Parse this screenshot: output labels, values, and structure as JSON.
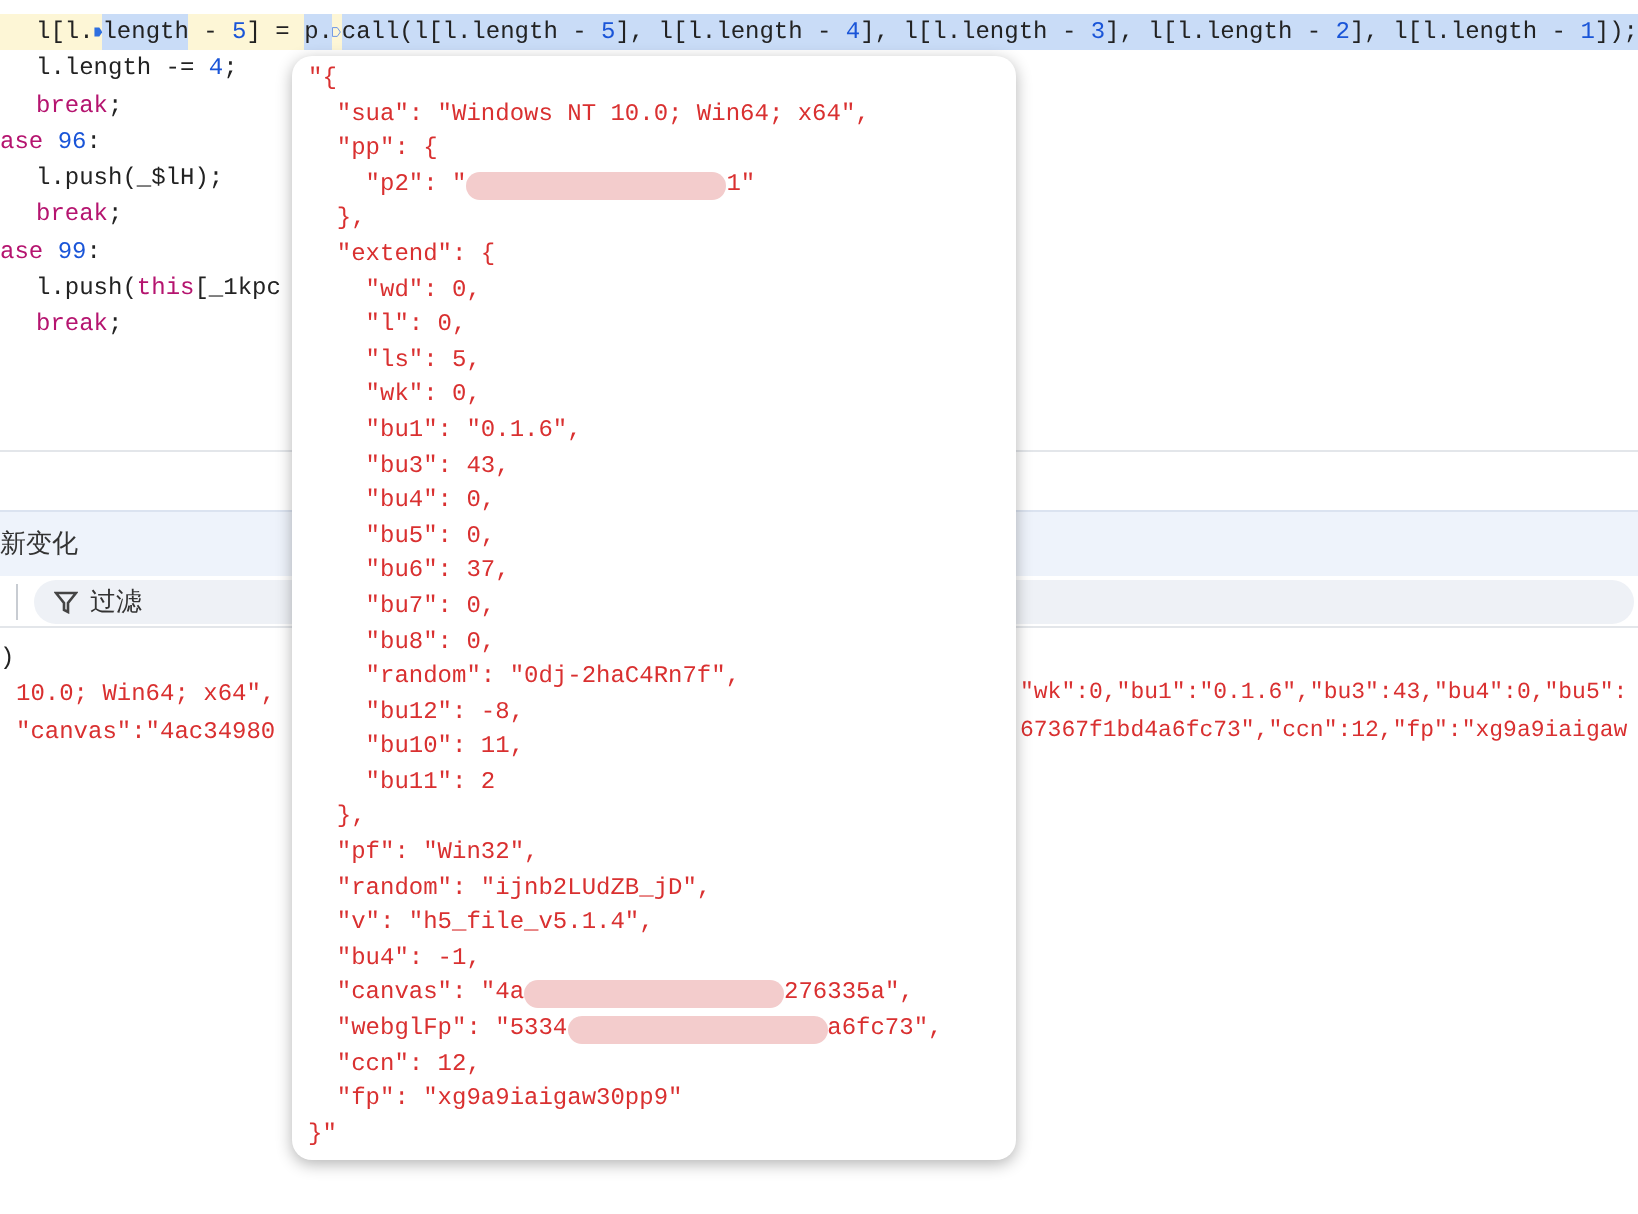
{
  "code_lines": [
    {
      "highlighted": true,
      "indent": true,
      "tokens": [
        {
          "kind": "plain",
          "text": "l[l.",
          "selected": false
        },
        {
          "kind": "breakpoint",
          "filled": true
        },
        {
          "kind": "plain",
          "text": "length",
          "selected": true
        },
        {
          "kind": "plain",
          "text": " - ",
          "selected": false
        },
        {
          "kind": "number",
          "text": "5",
          "selected": false
        },
        {
          "kind": "plain",
          "text": "] = ",
          "selected": false
        },
        {
          "kind": "plain",
          "text": "p.",
          "selected": true
        },
        {
          "kind": "breakpoint",
          "filled": false
        },
        {
          "kind": "plain",
          "text": "call(l[l.length - ",
          "selected": true
        },
        {
          "kind": "number",
          "text": "5",
          "selected": true
        },
        {
          "kind": "plain",
          "text": "], l[l.length - ",
          "selected": true
        },
        {
          "kind": "number",
          "text": "4",
          "selected": true
        },
        {
          "kind": "plain",
          "text": "], l[l.length - ",
          "selected": true
        },
        {
          "kind": "number",
          "text": "3",
          "selected": true
        },
        {
          "kind": "plain",
          "text": "], l[l.length - ",
          "selected": true
        },
        {
          "kind": "number",
          "text": "2",
          "selected": true
        },
        {
          "kind": "plain",
          "text": "], l[l.length - ",
          "selected": true
        },
        {
          "kind": "number",
          "text": "1",
          "selected": true
        },
        {
          "kind": "plain",
          "text": "]);",
          "selected": true
        }
      ]
    },
    {
      "highlighted": false,
      "indent": true,
      "tokens": [
        {
          "kind": "plain",
          "text": "l.length -= ",
          "selected": false
        },
        {
          "kind": "number",
          "text": "4",
          "selected": false
        },
        {
          "kind": "plain",
          "text": ";",
          "selected": false
        }
      ]
    },
    {
      "highlighted": false,
      "indent": true,
      "tokens": [
        {
          "kind": "keyword",
          "text": "break",
          "selected": false
        },
        {
          "kind": "plain",
          "text": ";",
          "selected": false
        }
      ]
    },
    {
      "highlighted": false,
      "indent": false,
      "tokens": [
        {
          "kind": "keyword",
          "text": "ase ",
          "selected": false
        },
        {
          "kind": "number",
          "text": "96",
          "selected": false
        },
        {
          "kind": "plain",
          "text": ":",
          "selected": false
        }
      ]
    },
    {
      "highlighted": false,
      "indent": true,
      "tokens": [
        {
          "kind": "plain",
          "text": "l.push(_$lH);",
          "selected": false
        }
      ]
    },
    {
      "highlighted": false,
      "indent": true,
      "tokens": [
        {
          "kind": "keyword",
          "text": "break",
          "selected": false
        },
        {
          "kind": "plain",
          "text": ";",
          "selected": false
        }
      ]
    },
    {
      "highlighted": false,
      "indent": false,
      "tokens": [
        {
          "kind": "keyword",
          "text": "ase ",
          "selected": false
        },
        {
          "kind": "number",
          "text": "99",
          "selected": false
        },
        {
          "kind": "plain",
          "text": ":",
          "selected": false
        }
      ]
    },
    {
      "highlighted": false,
      "indent": true,
      "tokens": [
        {
          "kind": "plain",
          "text": "l.push(",
          "selected": false
        },
        {
          "kind": "keyword",
          "text": "this",
          "selected": false
        },
        {
          "kind": "plain",
          "text": "[_1kpc",
          "selected": false
        }
      ]
    },
    {
      "highlighted": false,
      "indent": true,
      "tokens": [
        {
          "kind": "keyword",
          "text": "break",
          "selected": false
        },
        {
          "kind": "plain",
          "text": ";",
          "selected": false
        }
      ]
    }
  ],
  "panel": {
    "title": "新变化",
    "filter": {
      "label": "过滤"
    }
  },
  "console": {
    "lines": [
      {
        "left": ")"
      },
      {
        "left": "10.0; Win64; x64\",",
        "right": "\"wk\":0,\"bu1\":\"0.1.6\",\"bu3\":43,\"bu4\":0,\"bu5\":"
      },
      {
        "left": "\"canvas\":\"4ac34980",
        "right": "67367f1bd4a6fc73\",\"ccn\":12,\"fp\":\"xg9a9iaigaw"
      }
    ]
  },
  "popup": {
    "lines": [
      {
        "text": "\"{"
      },
      {
        "text": "  \"sua\": \"Windows NT 10.0; Win64; x64\","
      },
      {
        "text": "  \"pp\": {"
      },
      {
        "text": "    \"p2\": \"",
        "redacted": true,
        "after": "1\""
      },
      {
        "text": "  },"
      },
      {
        "text": "  \"extend\": {"
      },
      {
        "text": "    \"wd\": 0,"
      },
      {
        "text": "    \"l\": 0,"
      },
      {
        "text": "    \"ls\": 5,"
      },
      {
        "text": "    \"wk\": 0,"
      },
      {
        "text": "    \"bu1\": \"0.1.6\","
      },
      {
        "text": "    \"bu3\": 43,"
      },
      {
        "text": "    \"bu4\": 0,"
      },
      {
        "text": "    \"bu5\": 0,"
      },
      {
        "text": "    \"bu6\": 37,"
      },
      {
        "text": "    \"bu7\": 0,"
      },
      {
        "text": "    \"bu8\": 0,"
      },
      {
        "text": "    \"random\": \"0dj-2haC4Rn7f\","
      },
      {
        "text": "    \"bu12\": -8,"
      },
      {
        "text": "    \"bu10\": 11,"
      },
      {
        "text": "    \"bu11\": 2"
      },
      {
        "text": "  },"
      },
      {
        "text": "  \"pf\": \"Win32\","
      },
      {
        "text": "  \"random\": \"ijnb2LUdZB_jD\","
      },
      {
        "text": "  \"v\": \"h5_file_v5.1.4\","
      },
      {
        "text": "  \"bu4\": -1,"
      },
      {
        "text": "  \"canvas\": \"4a",
        "redacted": true,
        "after": "276335a\","
      },
      {
        "text": "  \"webglFp\": \"5334",
        "redacted": true,
        "after": "a6fc73\","
      },
      {
        "text": "  \"ccn\": 12,"
      },
      {
        "text": "  \"fp\": \"xg9a9iaigaw30pp9\""
      },
      {
        "text": "}\""
      }
    ]
  }
}
